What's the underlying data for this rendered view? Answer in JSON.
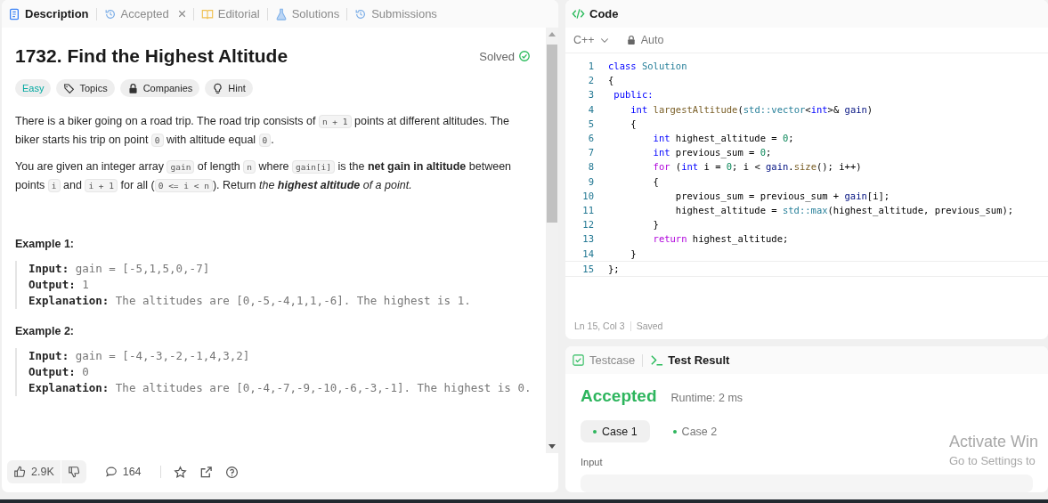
{
  "left_panel": {
    "tabs": [
      {
        "label": "Description",
        "selected": true,
        "closable": false,
        "kind": "description"
      },
      {
        "label": "Accepted",
        "selected": false,
        "closable": true,
        "kind": "submission"
      },
      {
        "label": "Editorial",
        "selected": false,
        "closable": false,
        "kind": "editorial"
      },
      {
        "label": "Solutions",
        "selected": false,
        "closable": false,
        "kind": "solutions"
      },
      {
        "label": "Submissions",
        "selected": false,
        "closable": false,
        "kind": "submission"
      }
    ],
    "problem": {
      "title": "1732. Find the Highest Altitude",
      "status": "Solved",
      "solved": true,
      "tags": [
        {
          "label": "Easy",
          "kind": "difficulty"
        },
        {
          "label": "Topics",
          "kind": "topics"
        },
        {
          "label": "Companies",
          "kind": "companies"
        },
        {
          "label": "Hint",
          "kind": "hint"
        }
      ],
      "paragraphs": [
        [
          {
            "kind": "text",
            "text": "There is a biker going on a road trip. The road trip consists of "
          },
          {
            "kind": "code",
            "text": "n + 1"
          },
          {
            "kind": "text",
            "text": " points at different altitudes. The biker starts his trip on point "
          },
          {
            "kind": "code",
            "text": "0"
          },
          {
            "kind": "text",
            "text": " with altitude equal "
          },
          {
            "kind": "code",
            "text": "0"
          },
          {
            "kind": "text",
            "text": "."
          }
        ],
        [
          {
            "kind": "text",
            "text": "You are given an integer array "
          },
          {
            "kind": "code",
            "text": "gain"
          },
          {
            "kind": "text",
            "text": " of length "
          },
          {
            "kind": "code",
            "text": "n"
          },
          {
            "kind": "text",
            "text": " where "
          },
          {
            "kind": "code",
            "text": "gain[i]"
          },
          {
            "kind": "text",
            "text": " is the "
          },
          {
            "kind": "bold",
            "text": "net gain in altitude"
          },
          {
            "kind": "text",
            "text": " between points "
          },
          {
            "kind": "code",
            "text": "i"
          },
          {
            "kind": "text",
            "text": " and "
          },
          {
            "kind": "code",
            "text": "i + 1"
          },
          {
            "kind": "text",
            "text": " for all ("
          },
          {
            "kind": "code",
            "text": "0 <= i < n"
          },
          {
            "kind": "text",
            "text": "). Return "
          },
          {
            "kind": "italic",
            "text": "the "
          },
          {
            "kind": "bolditalic",
            "text": "highest altitude"
          },
          {
            "kind": "italic",
            "text": " of a point."
          }
        ]
      ],
      "examples": [
        {
          "heading": "Example 1:",
          "lines": [
            "**Input:** gain = [-5,1,5,0,-7]",
            "**Output:** 1",
            "**Explanation:** The altitudes are [0,-5,-4,1,1,-6]. The highest is 1."
          ]
        },
        {
          "heading": "Example 2:",
          "lines": [
            "**Input:** gain = [-4,-3,-2,-1,4,3,2]",
            "**Output:** 0",
            "**Explanation:** The altitudes are [0,-4,-7,-9,-10,-6,-3,-1]. The highest is 0."
          ]
        }
      ]
    },
    "footer": {
      "likes": "2.9K",
      "comments": "164"
    }
  },
  "code_panel": {
    "title": "Code",
    "language": "C++",
    "mode": "Auto",
    "lines": [
      {
        "number": "1",
        "tokens": [
          {
            "kind": "keyword",
            "text": "class"
          },
          {
            "kind": "type",
            "text": " Solution"
          }
        ]
      },
      {
        "number": "2",
        "tokens": [
          {
            "kind": "plain",
            "text": "{"
          }
        ]
      },
      {
        "number": "3",
        "tokens": [
          {
            "kind": "keyword",
            "text": " public:"
          }
        ]
      },
      {
        "number": "4",
        "tokens": [
          {
            "kind": "keyword",
            "text": "    int"
          },
          {
            "kind": "function",
            "text": " largestAltitude"
          },
          {
            "kind": "plain",
            "text": "("
          },
          {
            "kind": "type",
            "text": "std::vector"
          },
          {
            "kind": "plain",
            "text": "<"
          },
          {
            "kind": "keyword",
            "text": "int"
          },
          {
            "kind": "plain",
            "text": ">& "
          },
          {
            "kind": "variable",
            "text": "gain"
          },
          {
            "kind": "plain",
            "text": ")"
          }
        ]
      },
      {
        "number": "5",
        "tokens": [
          {
            "kind": "plain",
            "text": "    {"
          }
        ]
      },
      {
        "number": "6",
        "tokens": [
          {
            "kind": "keyword",
            "text": "        int"
          },
          {
            "kind": "plain",
            "text": " highest_altitude = "
          },
          {
            "kind": "number",
            "text": "0"
          },
          {
            "kind": "plain",
            "text": ";"
          }
        ]
      },
      {
        "number": "7",
        "tokens": [
          {
            "kind": "keyword",
            "text": "        int"
          },
          {
            "kind": "plain",
            "text": " previous_sum = "
          },
          {
            "kind": "number",
            "text": "0"
          },
          {
            "kind": "plain",
            "text": ";"
          }
        ]
      },
      {
        "number": "8",
        "tokens": [
          {
            "kind": "control",
            "text": "        for"
          },
          {
            "kind": "plain",
            "text": " ("
          },
          {
            "kind": "keyword",
            "text": "int"
          },
          {
            "kind": "plain",
            "text": " i = "
          },
          {
            "kind": "number",
            "text": "0"
          },
          {
            "kind": "plain",
            "text": "; i < "
          },
          {
            "kind": "variable",
            "text": "gain"
          },
          {
            "kind": "plain",
            "text": "."
          },
          {
            "kind": "function",
            "text": "size"
          },
          {
            "kind": "plain",
            "text": "(); i++)"
          }
        ]
      },
      {
        "number": "9",
        "tokens": [
          {
            "kind": "plain",
            "text": "        {"
          }
        ]
      },
      {
        "number": "10",
        "tokens": [
          {
            "kind": "plain",
            "text": "            previous_sum = previous_sum + "
          },
          {
            "kind": "variable",
            "text": "gain"
          },
          {
            "kind": "plain",
            "text": "[i];"
          }
        ]
      },
      {
        "number": "11",
        "tokens": [
          {
            "kind": "plain",
            "text": "            highest_altitude = "
          },
          {
            "kind": "type",
            "text": "std::max"
          },
          {
            "kind": "plain",
            "text": "(highest_altitude, previous_sum);"
          }
        ]
      },
      {
        "number": "12",
        "tokens": [
          {
            "kind": "plain",
            "text": "        }"
          }
        ]
      },
      {
        "number": "13",
        "tokens": [
          {
            "kind": "control",
            "text": "        return"
          },
          {
            "kind": "plain",
            "text": " highest_altitude;"
          }
        ]
      },
      {
        "number": "14",
        "tokens": [
          {
            "kind": "plain",
            "text": "    }"
          }
        ]
      },
      {
        "number": "15",
        "tokens": [
          {
            "kind": "plain",
            "text": "};"
          }
        ]
      }
    ],
    "status": {
      "position": "Ln 15, Col 3",
      "saved": "Saved"
    }
  },
  "result_panel": {
    "tabs": [
      {
        "label": "Testcase",
        "selected": false,
        "kind": "testcase"
      },
      {
        "label": "Test Result",
        "selected": true,
        "kind": "result"
      }
    ],
    "verdict": "Accepted",
    "runtime": "Runtime: 2 ms",
    "cases": [
      {
        "label": "Case 1",
        "selected": true,
        "passed": true
      },
      {
        "label": "Case 2",
        "selected": false,
        "passed": true
      }
    ],
    "input_label": "Input"
  },
  "system_overlay": {
    "title": "Activate Win",
    "subtitle": "Go to Settings to"
  }
}
